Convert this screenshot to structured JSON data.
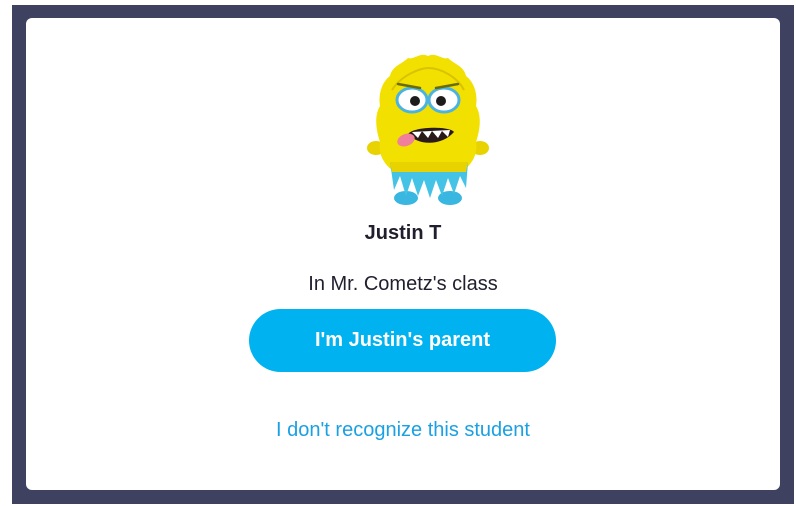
{
  "student": {
    "name": "Justin T",
    "class_text": "In Mr. Cometz's class",
    "avatar_icon": "yellow-monster-avatar"
  },
  "actions": {
    "parent_button_label": "I'm Justin's parent",
    "dont_recognize_label": "I don't recognize this student"
  },
  "colors": {
    "frame": "#3f4160",
    "accent": "#00b2ef",
    "link": "#1aa0e3"
  }
}
